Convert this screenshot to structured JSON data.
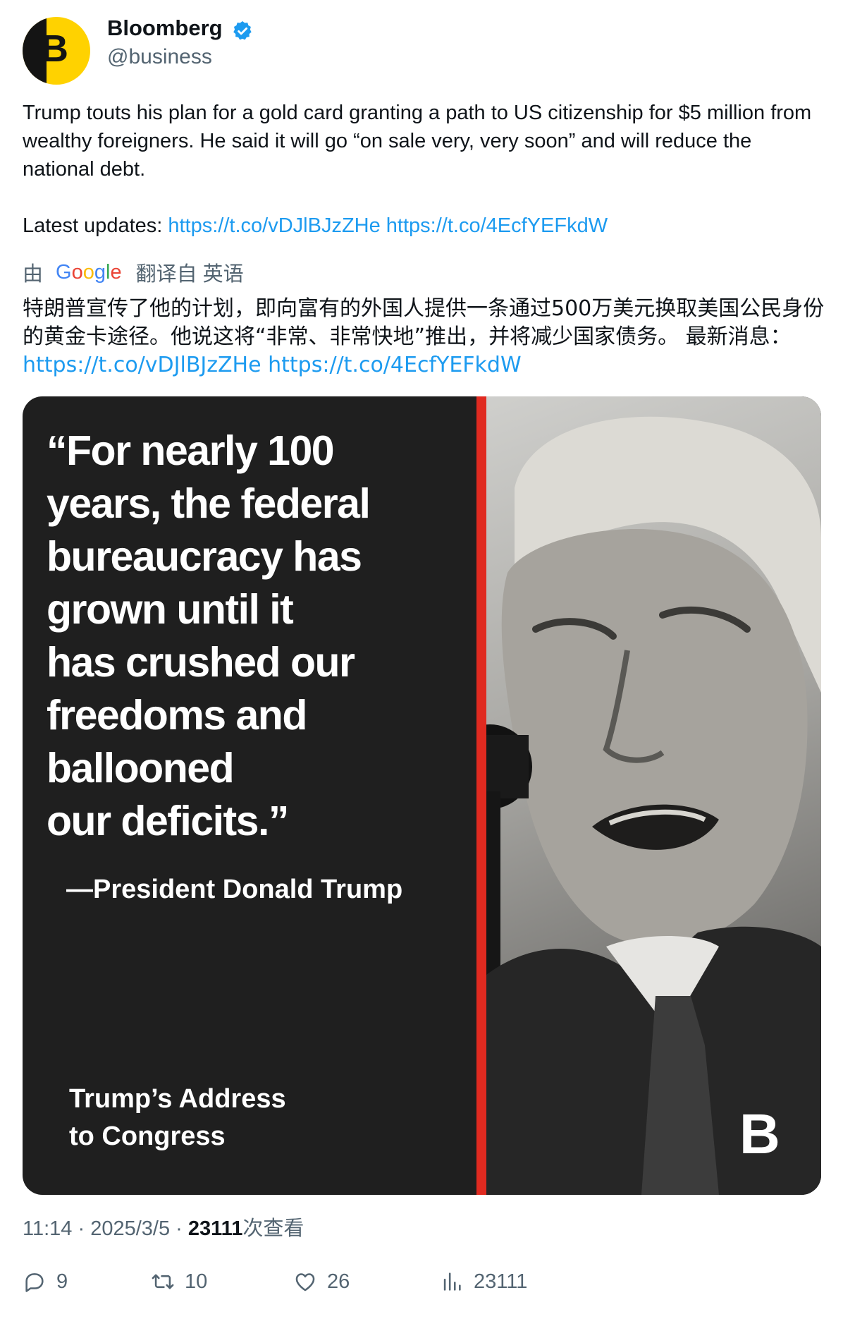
{
  "author": {
    "avatar_letter": "B",
    "name": "Bloomberg",
    "handle": "@business",
    "verified_icon": "verified-badge-icon",
    "brand_color": "#ffd200"
  },
  "tweet": {
    "text": "Trump touts his plan for a gold card granting a path to US citizenship for $5 million from wealthy foreigners. He said it will go “on sale very, very soon” and will reduce the national debt.",
    "updates_label": "Latest updates: ",
    "link1": "https://t.co/vDJlBJzZHe",
    "link2": "https://t.co/4EcfYEFkdW"
  },
  "translation": {
    "prefix": "由",
    "provider": "Google",
    "suffix": "翻译自 英语",
    "text": "特朗普宣传了他的计划，即向富有的外国人提供一条通过500万美元换取美国公民身份的黄金卡途径。他说这将“非常、非常快地”推出，并将减少国家债务。 最新消息：",
    "link1": "https://t.co/vDJlBJzZHe",
    "link2": "https://t.co/4EcfYEFkdW"
  },
  "media": {
    "quote": "“For nearly 100\n  years, the federal\n  bureaucracy has\n  grown until it\n  has crushed our\n  freedoms and\n  ballooned\n  our deficits.”",
    "attribution": "—President Donald Trump",
    "event": "Trump’s Address\nto Congress",
    "logo": "B",
    "accent_color": "#e02a20"
  },
  "meta": {
    "time": "11:14",
    "sep1": " · ",
    "date": "2025/3/5",
    "sep2": " · ",
    "views": "23111",
    "views_label": "次查看"
  },
  "actions": {
    "replies": "9",
    "retweets": "10",
    "likes": "26",
    "views": "23111"
  }
}
